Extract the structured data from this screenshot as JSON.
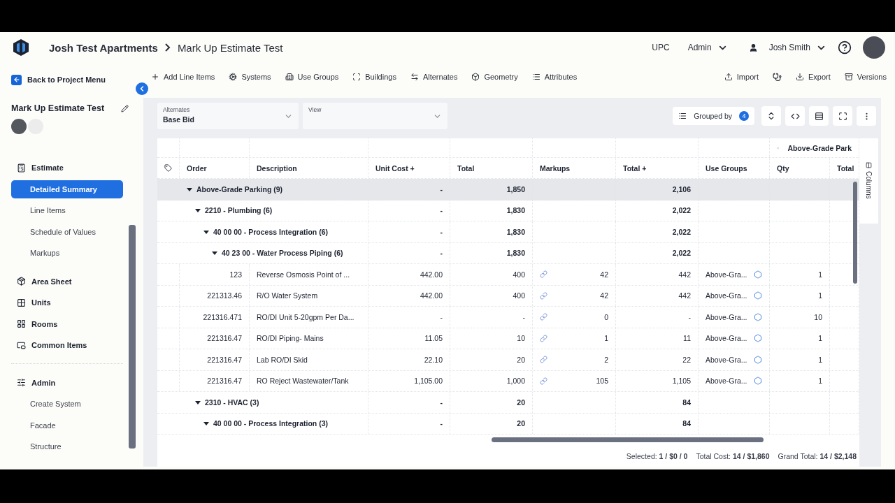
{
  "header": {
    "breadcrumb": [
      "Josh Test Apartments",
      "Mark Up Estimate Test"
    ],
    "org": "UPC",
    "role": "Admin",
    "user": "Josh Smith"
  },
  "sidebar": {
    "back": "Back to Project Menu",
    "project_title": "Mark Up Estimate Test",
    "nav_groups": [
      {
        "items": [
          {
            "label": "Estimate",
            "children": [
              {
                "label": "Detailed Summary",
                "selected": true
              },
              {
                "label": "Line Items",
                "selected": false
              },
              {
                "label": "Schedule of Values",
                "selected": false
              },
              {
                "label": "Markups",
                "selected": false
              }
            ]
          },
          {
            "label": "Area Sheet"
          },
          {
            "label": "Units"
          },
          {
            "label": "Rooms"
          },
          {
            "label": "Common Items"
          }
        ]
      },
      {
        "items": [
          {
            "label": "Admin",
            "children": [
              {
                "label": "Create System",
                "selected": false
              },
              {
                "label": "Facade",
                "selected": false
              },
              {
                "label": "Structure",
                "selected": false
              }
            ]
          }
        ]
      }
    ]
  },
  "toolbar": {
    "left": [
      "Add Line Items",
      "Systems",
      "Use Groups",
      "Buildings",
      "Alternates",
      "Geometry",
      "Attributes"
    ],
    "right": [
      "Import",
      "Export",
      "Versions"
    ]
  },
  "filters": [
    {
      "label": "Alternates",
      "value": "Base Bid"
    },
    {
      "label": "View"
    }
  ],
  "grouped_by": {
    "label": "Grouped by",
    "count": "4"
  },
  "table": {
    "column_group": "Above-Grade Park",
    "columns": [
      "Order",
      "Description",
      "Unit Cost +",
      "Total",
      "Markups",
      "Total +",
      "Use Groups",
      "Qty",
      "Total"
    ],
    "rows": [
      {
        "kind": "group",
        "label": "Above-Grade Parking (9)",
        "unit_cost": "-",
        "total": "1,850",
        "total_plus": "2,106",
        "selected": true,
        "expanded": true,
        "children": [
          {
            "kind": "group",
            "label": "2210 - Plumbing (6)",
            "unit_cost": "-",
            "total": "1,830",
            "total_plus": "2,022",
            "selected": false,
            "expanded": true,
            "children": [
              {
                "kind": "group",
                "label": "40 00 00 - Process Integration (6)",
                "unit_cost": "-",
                "total": "1,830",
                "total_plus": "2,022",
                "selected": false,
                "expanded": true,
                "children": [
                  {
                    "kind": "group",
                    "label": "40 23 00 - Water Process Piping (6)",
                    "unit_cost": "-",
                    "total": "1,830",
                    "total_plus": "2,022",
                    "selected": false,
                    "expanded": true,
                    "children": [
                      {
                        "kind": "item",
                        "order": "123",
                        "description": "Reverse Osmosis Point of ...",
                        "unit_cost": "442.00",
                        "total": "400",
                        "markup": "42",
                        "total_plus": "442",
                        "use_group": "Above-Gra...",
                        "qty": "1",
                        "selected": false
                      },
                      {
                        "kind": "item",
                        "order": "221313.46",
                        "description": "R/O Water System",
                        "unit_cost": "442.00",
                        "total": "400",
                        "markup": "42",
                        "total_plus": "442",
                        "use_group": "Above-Gra...",
                        "qty": "1",
                        "selected": false
                      },
                      {
                        "kind": "item",
                        "order": "221316.471",
                        "description": "RO/DI Unit 5-20gpm Per Da...",
                        "unit_cost": "-",
                        "total": "-",
                        "markup": "0",
                        "total_plus": "-",
                        "use_group": "Above-Gra...",
                        "qty": "10",
                        "selected": false
                      },
                      {
                        "kind": "item",
                        "order": "221316.47",
                        "description": "RO/DI  Piping- Mains",
                        "unit_cost": "11.05",
                        "total": "10",
                        "markup": "1",
                        "total_plus": "11",
                        "use_group": "Above-Gra...",
                        "qty": "1",
                        "selected": false
                      },
                      {
                        "kind": "item",
                        "order": "221316.47",
                        "description": "Lab RO/DI Skid",
                        "unit_cost": "22.10",
                        "total": "20",
                        "markup": "2",
                        "total_plus": "22",
                        "use_group": "Above-Gra...",
                        "qty": "1",
                        "selected": false
                      },
                      {
                        "kind": "item",
                        "order": "221316.47",
                        "description": "RO Reject Wastewater/Tank",
                        "unit_cost": "1,105.00",
                        "total": "1,000",
                        "markup": "105",
                        "total_plus": "1,105",
                        "use_group": "Above-Gra...",
                        "qty": "1",
                        "selected": false
                      }
                    ]
                  }
                ]
              }
            ]
          },
          {
            "kind": "group",
            "label": "2310 - HVAC (3)",
            "unit_cost": "-",
            "total": "20",
            "total_plus": "84",
            "selected": false,
            "expanded": true,
            "children": [
              {
                "kind": "group",
                "label": "40 00 00 - Process Integration (3)",
                "unit_cost": "-",
                "total": "20",
                "total_plus": "84",
                "selected": false,
                "expanded": true
              }
            ]
          }
        ]
      }
    ]
  },
  "side_tab": "Columns",
  "footer": [
    "Selected: **1 / $0 / 0**",
    "Total Cost: **14 / $1,860**",
    "Grand Total: **14 / $2,148**"
  ]
}
